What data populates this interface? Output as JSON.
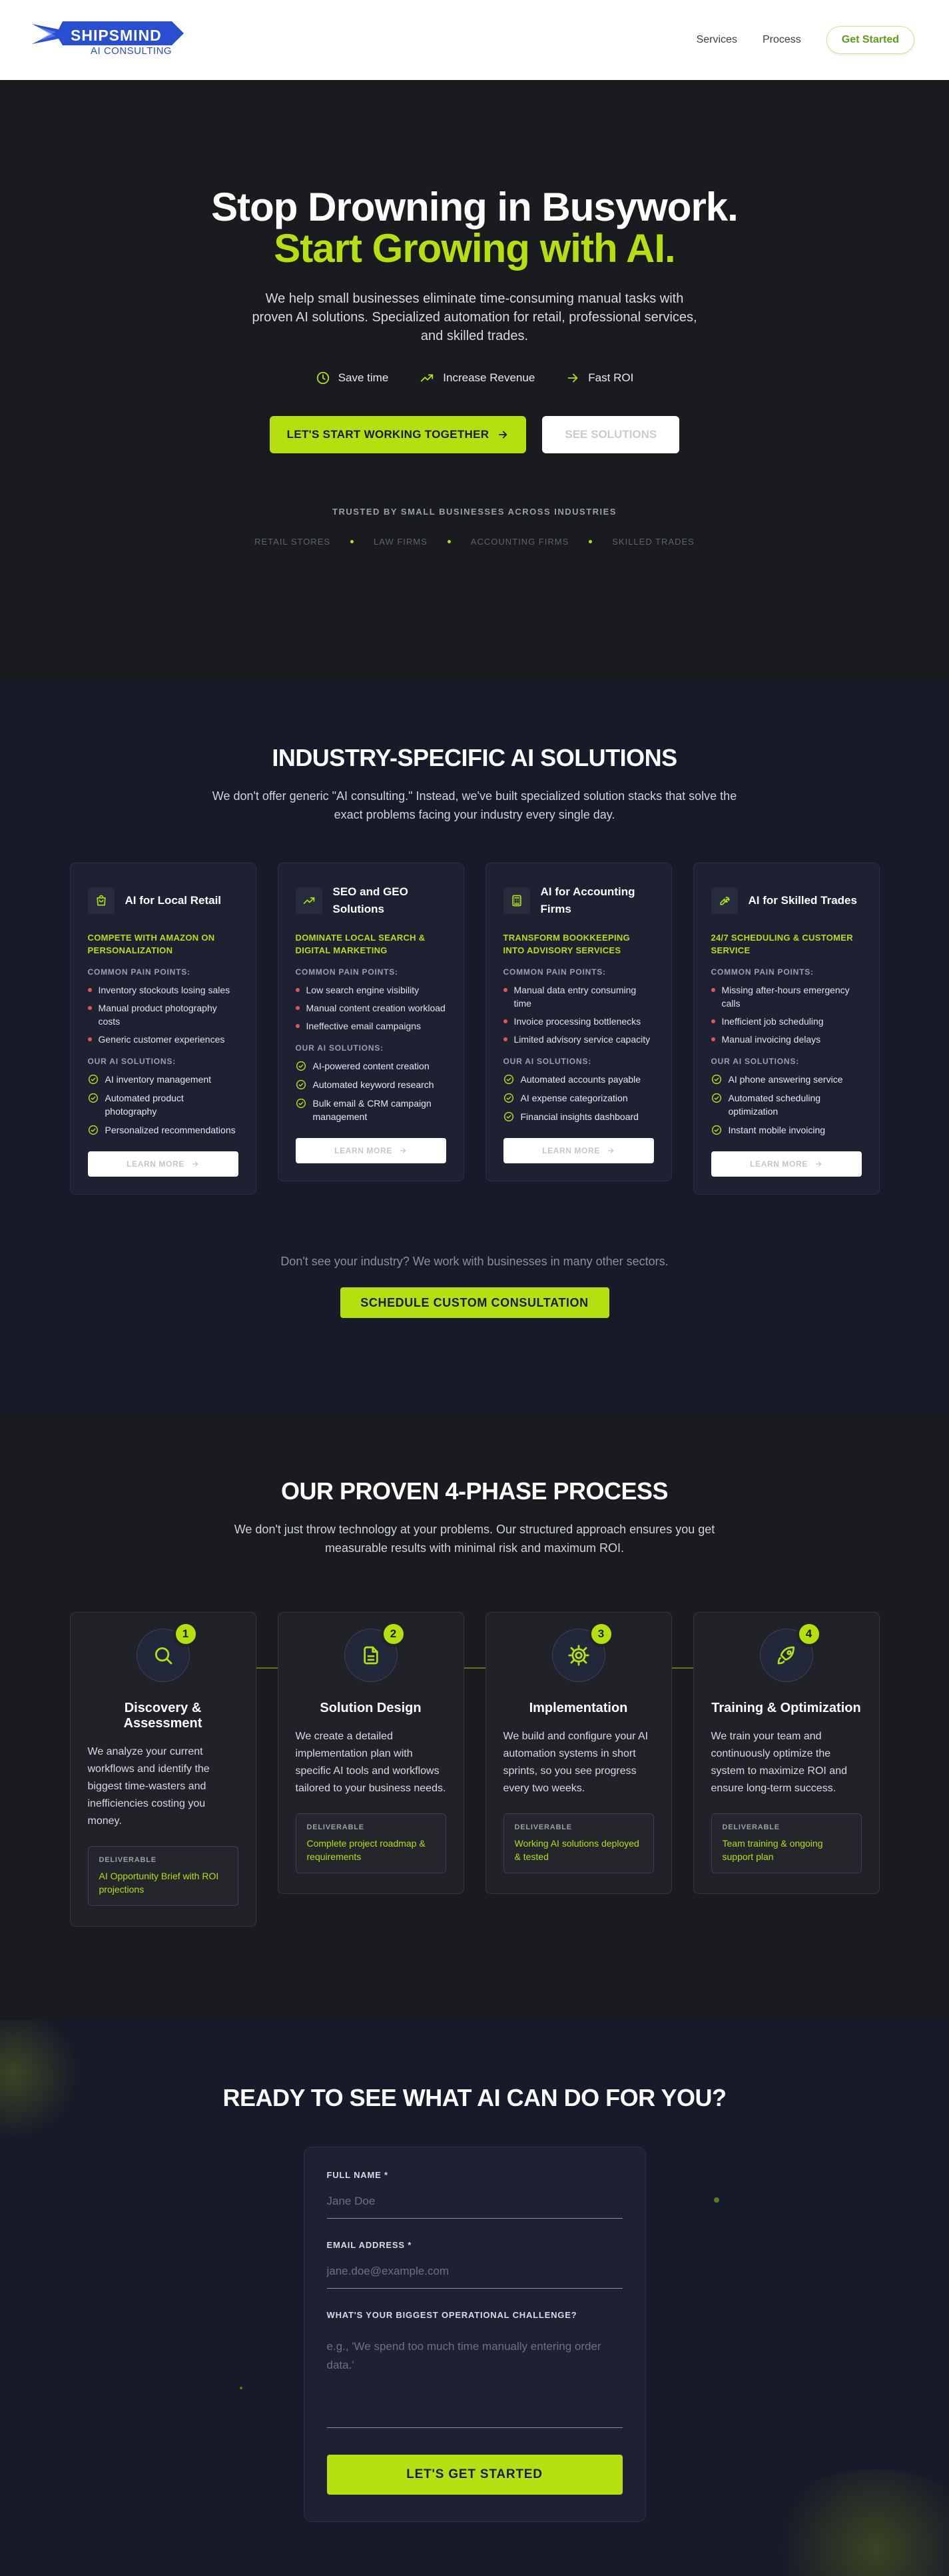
{
  "nav": {
    "logo_name": "SHIPSMIND",
    "logo_sub": "AI CONSULTING",
    "links": [
      "Services",
      "Process"
    ],
    "cta": "Get Started"
  },
  "hero": {
    "title_line1": "Stop Drowning in Busywork.",
    "title_line2": "Start Growing with AI.",
    "subtitle": "We help small businesses eliminate time-consuming manual tasks with proven AI solutions. Specialized automation for retail, professional services, and skilled trades.",
    "features": [
      {
        "icon": "clock-icon",
        "label": "Save time"
      },
      {
        "icon": "trending-up-icon",
        "label": "Increase Revenue"
      },
      {
        "icon": "arrow-right-icon",
        "label": "Fast ROI"
      }
    ],
    "primary_button": "LET'S START WORKING TOGETHER",
    "secondary_button": "SEE SOLUTIONS",
    "trusted_label": "TRUSTED BY SMALL BUSINESSES ACROSS INDUSTRIES",
    "trusted_list": [
      "RETAIL STORES",
      "LAW FIRMS",
      "ACCOUNTING FIRMS",
      "SKILLED TRADES"
    ]
  },
  "industry": {
    "title": "INDUSTRY-SPECIFIC AI SOLUTIONS",
    "subtitle": "We don't offer generic \"AI consulting.\" Instead, we've built specialized solution stacks that solve the exact problems facing your industry every single day.",
    "pain_label": "COMMON PAIN POINTS:",
    "solutions_label": "OUR AI SOLUTIONS:",
    "learn_more": "LEARN MORE",
    "cards": [
      {
        "icon": "shopping-bag-icon",
        "title": "AI for Local Retail",
        "tagline": "COMPETE WITH AMAZON ON PERSONALIZATION",
        "pains": [
          "Inventory stockouts losing sales",
          "Manual product photography costs",
          "Generic customer experiences"
        ],
        "solutions": [
          "AI inventory management",
          "Automated product photography",
          "Personalized recommendations"
        ]
      },
      {
        "icon": "trending-up-icon",
        "title": "SEO and GEO Solutions",
        "tagline": "DOMINATE LOCAL SEARCH & DIGITAL MARKETING",
        "pains": [
          "Low search engine visibility",
          "Manual content creation workload",
          "Ineffective email campaigns"
        ],
        "solutions": [
          "AI-powered content creation",
          "Automated keyword research",
          "Bulk email & CRM campaign management"
        ]
      },
      {
        "icon": "calculator-icon",
        "title": "AI for Accounting Firms",
        "tagline": "TRANSFORM BOOKKEEPING INTO ADVISORY SERVICES",
        "pains": [
          "Manual data entry consuming time",
          "Invoice processing bottlenecks",
          "Limited advisory service capacity"
        ],
        "solutions": [
          "Automated accounts payable",
          "AI expense categorization",
          "Financial insights dashboard"
        ]
      },
      {
        "icon": "wrench-icon",
        "title": "AI for Skilled Trades",
        "tagline": "24/7 SCHEDULING & CUSTOMER SERVICE",
        "pains": [
          "Missing after-hours emergency calls",
          "Inefficient job scheduling",
          "Manual invoicing delays"
        ],
        "solutions": [
          "AI phone answering service",
          "Automated scheduling optimization",
          "Instant mobile invoicing"
        ]
      }
    ],
    "other_text": "Don't see your industry? We work with businesses in many other sectors.",
    "schedule_button": "SCHEDULE CUSTOM CONSULTATION"
  },
  "process": {
    "title": "OUR PROVEN 4-PHASE PROCESS",
    "subtitle": "We don't just throw technology at your problems. Our structured approach ensures you get measurable results with minimal risk and maximum ROI.",
    "deliverable_label": "DELIVERABLE",
    "phases": [
      {
        "num": "1",
        "icon": "search-icon",
        "title": "Discovery & Assessment",
        "text": "We analyze your current workflows and identify the biggest time-wasters and inefficiencies costing you money.",
        "deliverable": "AI Opportunity Brief with ROI projections"
      },
      {
        "num": "2",
        "icon": "document-icon",
        "title": "Solution Design",
        "text": "We create a detailed implementation plan with specific AI tools and workflows tailored to your business needs.",
        "deliverable": "Complete project roadmap & requirements"
      },
      {
        "num": "3",
        "icon": "gear-icon",
        "title": "Implementation",
        "text": "We build and configure your AI automation systems in short sprints, so you see progress every two weeks.",
        "deliverable": "Working AI solutions deployed & tested"
      },
      {
        "num": "4",
        "icon": "rocket-icon",
        "title": "Training & Optimization",
        "text": "We train your team and continuously optimize the system to maximize ROI and ensure long-term success.",
        "deliverable": "Team training & ongoing support plan"
      }
    ]
  },
  "contact": {
    "title": "READY TO SEE WHAT AI CAN DO FOR YOU?",
    "name_label": "FULL NAME *",
    "name_placeholder": "Jane Doe",
    "email_label": "EMAIL ADDRESS *",
    "email_placeholder": "jane.doe@example.com",
    "challenge_label": "WHAT'S YOUR BIGGEST OPERATIONAL CHALLENGE?",
    "challenge_placeholder": "e.g., 'We spend too much time manually entering order data.'",
    "submit": "LET'S GET STARTED"
  },
  "colors": {
    "accent": "#b4e010",
    "dark": "#1a1b1f",
    "navy": "#161a29",
    "brand_blue": "#2a4ecf"
  }
}
